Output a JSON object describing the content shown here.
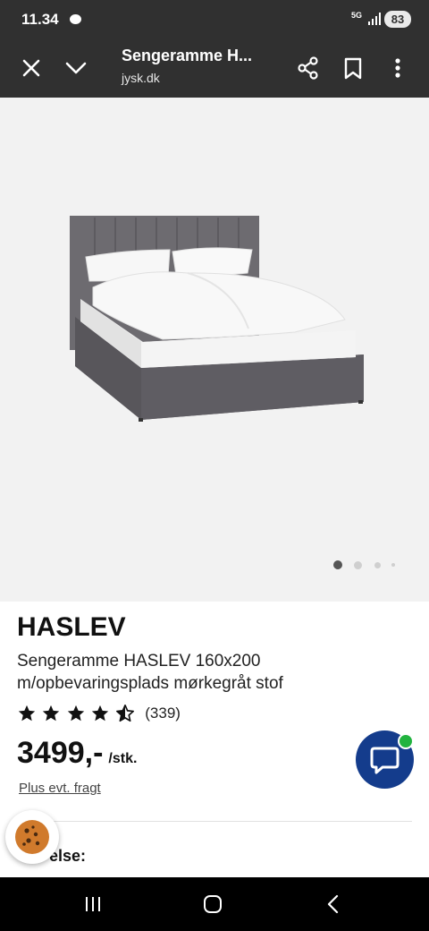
{
  "status_bar": {
    "time": "11.34",
    "network": "5G",
    "battery": "83"
  },
  "browser_toolbar": {
    "title": "Sengeramme H...",
    "url": "jysk.dk"
  },
  "gallery": {
    "image_alt": "Sengeramme HASLEV",
    "dot_count": 4,
    "active_index": 0
  },
  "product": {
    "brand": "HASLEV",
    "description": "Sengeramme HASLEV 160x200 m/opbevaringsplads mørkegråt stof",
    "rating": 4.5,
    "review_count": "(339)",
    "price": "3499,-",
    "price_unit": "/stk.",
    "freight_note": "Plus evt. fragt",
    "section_label_partial": "else:"
  },
  "colors": {
    "top_bar": "#303030",
    "page_background": "#ffffff",
    "gallery_background": "#f2f2f2",
    "chat_button": "#143c8c",
    "online_indicator": "#21b33f",
    "cookie_badge": "#d07a2c"
  },
  "icons": {
    "close": "close-icon",
    "collapse": "chevron-down-icon",
    "share": "share-icon",
    "bookmark": "bookmark-icon",
    "menu": "more-vert-icon",
    "chat": "chat-bubble-icon",
    "cookie": "cookie-icon",
    "nav_recents": "recents-icon",
    "nav_home": "home-icon",
    "nav_back": "back-icon"
  }
}
